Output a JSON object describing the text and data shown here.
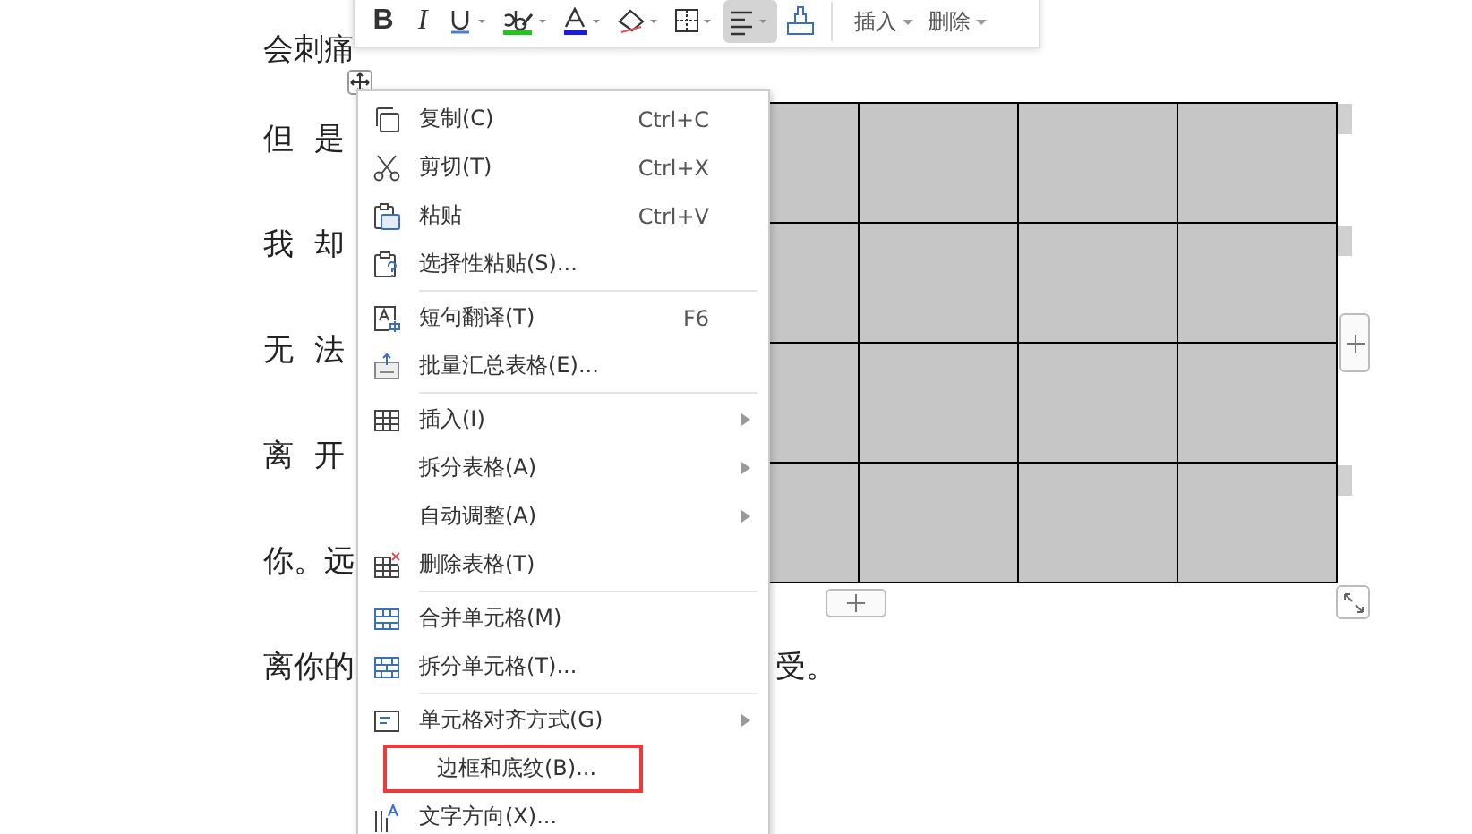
{
  "document": {
    "lines": [
      {
        "text": "会刺痛"
      },
      {
        "text": "但 是"
      },
      {
        "text": "我 却"
      },
      {
        "text": "无 法"
      },
      {
        "text": "离 开"
      },
      {
        "text": "你。远"
      }
    ],
    "last_line": {
      "start": "离你的",
      "end": "受。"
    }
  },
  "table": {
    "rows": [
      {
        "cells": [
          {
            "shaded": true
          },
          {
            "shaded": true
          },
          {
            "shaded": true
          },
          {
            "shaded": true
          }
        ]
      },
      {
        "cells": [
          {
            "shaded": true
          },
          {
            "shaded": true
          },
          {
            "shaded": true
          },
          {
            "shaded": true
          }
        ]
      },
      {
        "cells": [
          {
            "shaded": true
          },
          {
            "shaded": true
          },
          {
            "shaded": true
          },
          {
            "shaded": true
          }
        ]
      },
      {
        "cells": [
          {
            "shaded": true
          },
          {
            "shaded": true
          },
          {
            "shaded": true
          },
          {
            "shaded": true
          }
        ]
      }
    ]
  },
  "toolbar": {
    "buttons": [
      {
        "kind": "bold",
        "label": "B",
        "selected": false
      },
      {
        "kind": "italic",
        "label": "I",
        "selected": false
      },
      {
        "kind": "underline",
        "selected": false
      },
      {
        "kind": "highlight",
        "selected": false
      },
      {
        "kind": "font-color",
        "selected": false
      },
      {
        "kind": "shading",
        "selected": false
      },
      {
        "kind": "borders",
        "selected": false
      },
      {
        "kind": "align",
        "selected": true
      },
      {
        "kind": "format-painter",
        "selected": false
      }
    ],
    "menus": [
      {
        "label": "插入"
      },
      {
        "label": "删除"
      }
    ]
  },
  "context_menu": {
    "items": [
      {
        "kind": "item",
        "label": "复制(C)",
        "shortcut": "Ctrl+C",
        "submenu": false,
        "outlined": false
      },
      {
        "kind": "item",
        "label": "剪切(T)",
        "shortcut": "Ctrl+X",
        "submenu": false,
        "outlined": false
      },
      {
        "kind": "item",
        "label": "粘贴",
        "shortcut": "Ctrl+V",
        "submenu": false,
        "outlined": false
      },
      {
        "kind": "item",
        "label": "选择性粘贴(S)...",
        "submenu": false,
        "outlined": false
      },
      {
        "kind": "separator"
      },
      {
        "kind": "item",
        "label": "短句翻译(T)",
        "shortcut": "F6",
        "submenu": false,
        "outlined": false
      },
      {
        "kind": "item",
        "label": "批量汇总表格(E)...",
        "submenu": false,
        "outlined": false
      },
      {
        "kind": "separator"
      },
      {
        "kind": "item",
        "label": "插入(I)",
        "submenu": true,
        "outlined": false
      },
      {
        "kind": "item",
        "label": "拆分表格(A)",
        "submenu": true,
        "outlined": false
      },
      {
        "kind": "item",
        "label": "自动调整(A)",
        "submenu": true,
        "outlined": false
      },
      {
        "kind": "item",
        "label": "删除表格(T)",
        "submenu": false,
        "outlined": false
      },
      {
        "kind": "separator"
      },
      {
        "kind": "item",
        "label": "合并单元格(M)",
        "submenu": false,
        "outlined": false
      },
      {
        "kind": "item",
        "label": "拆分单元格(T)...",
        "submenu": false,
        "outlined": false
      },
      {
        "kind": "separator"
      },
      {
        "kind": "item",
        "label": "单元格对齐方式(G)",
        "submenu": true,
        "outlined": false
      },
      {
        "kind": "item",
        "label": "边框和底纹(B)...",
        "submenu": false,
        "outlined": true
      },
      {
        "kind": "item",
        "label": "文字方向(X)...",
        "submenu": false,
        "outlined": false
      }
    ]
  }
}
